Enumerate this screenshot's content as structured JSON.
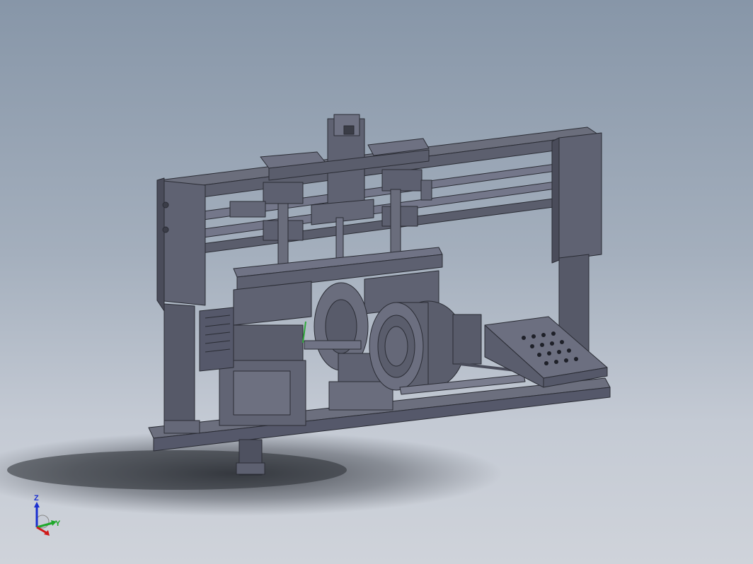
{
  "viewport": {
    "background_top": "#8796a8",
    "background_bottom": "#cfd3da",
    "model_color": "#5e6170",
    "edge_color": "#2a2c34"
  },
  "triad": {
    "z_label": "Z",
    "y_label": "Y",
    "z_color": "#1a2fd0",
    "y_color": "#1ea82a",
    "x_color": "#d01818"
  }
}
